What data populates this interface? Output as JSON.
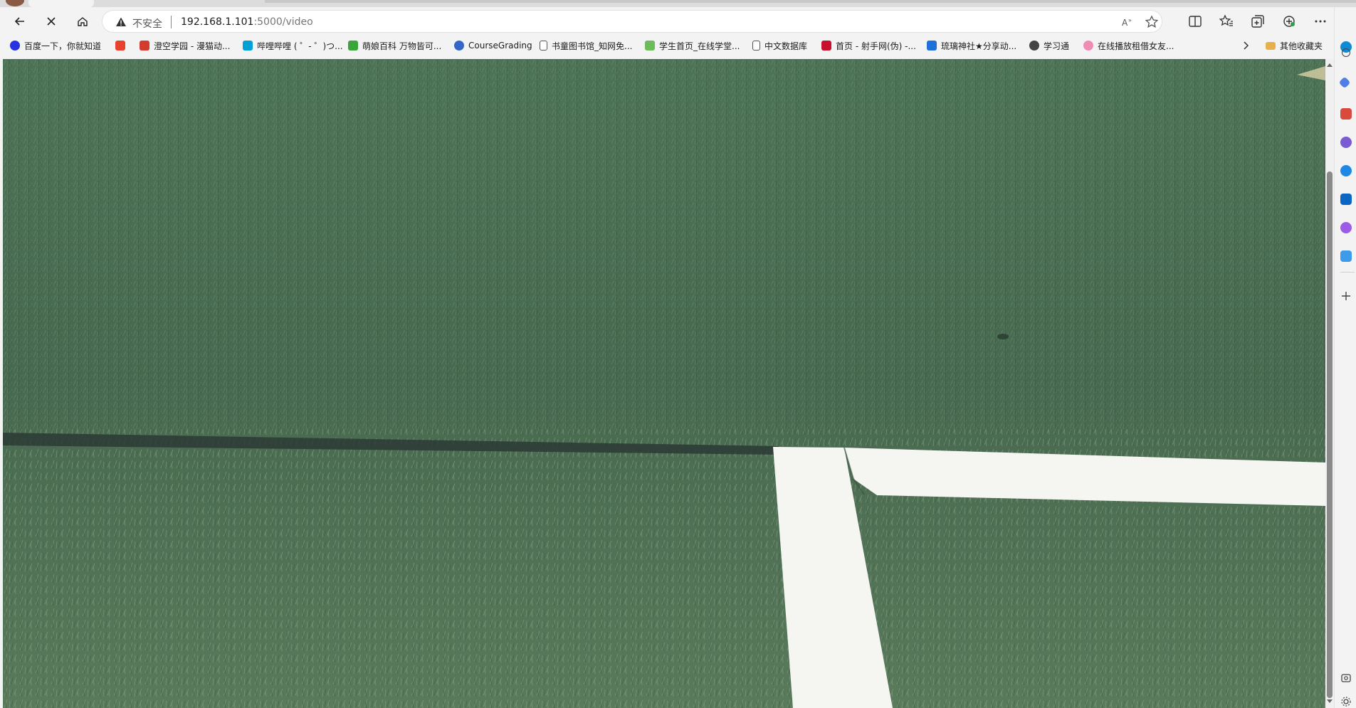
{
  "browser": {
    "tabs": [
      {
        "label": ""
      }
    ],
    "address_bar": {
      "security_label": "不安全",
      "url_host": "192.168.1.101",
      "url_path": ":5000/video"
    },
    "icons": {
      "back": "back-arrow-icon",
      "stop": "close-icon",
      "home": "home-icon",
      "warning": "warning-icon",
      "read_aloud": "read-aloud-icon",
      "favorite": "star-icon",
      "split": "split-screen-icon",
      "favorites": "favorites-icon",
      "collections": "collections-icon",
      "extensions": "extensions-icon",
      "more": "more-icon"
    }
  },
  "bookmarks": {
    "items": [
      {
        "label": "百度一下，你就知道",
        "color": "#2932e1"
      },
      {
        "label": "",
        "color": "#e8412c"
      },
      {
        "label": "澄空学园 - 漫猫动...",
        "color": "#d33b2c"
      },
      {
        "label": "哔哩哔哩 ( ゜- ゜)つ...",
        "color": "#00a1d6"
      },
      {
        "label": "萌娘百科 万物皆可...",
        "color": "#3aa53a"
      },
      {
        "label": "CourseGrading",
        "color": "#3567c8"
      },
      {
        "label": "书童图书馆_知网免...",
        "color": "#555555"
      },
      {
        "label": "学生首页_在线学堂...",
        "color": "#6dbb5a"
      },
      {
        "label": "中文数据库",
        "color": "#555555"
      },
      {
        "label": "首页 - 射手网(伪) -...",
        "color": "#c8102e"
      },
      {
        "label": "琉璃神社★分享动...",
        "color": "#1e6fd9"
      },
      {
        "label": "学习通",
        "color": "#444444"
      },
      {
        "label": "在线播放租借女友...",
        "color": "#f08bb5"
      }
    ],
    "overflow_icon": "chevron-right-icon",
    "other_folder": {
      "label": "其他收藏夹",
      "color": "#e8b04a"
    }
  },
  "video": {
    "description_icon": "video-stream"
  },
  "colors": {
    "grass_dark": "#3f6148",
    "grass_light": "#6f8f6a",
    "field_line": "#f5f5f2",
    "dark_strip": "#2c3a35"
  }
}
